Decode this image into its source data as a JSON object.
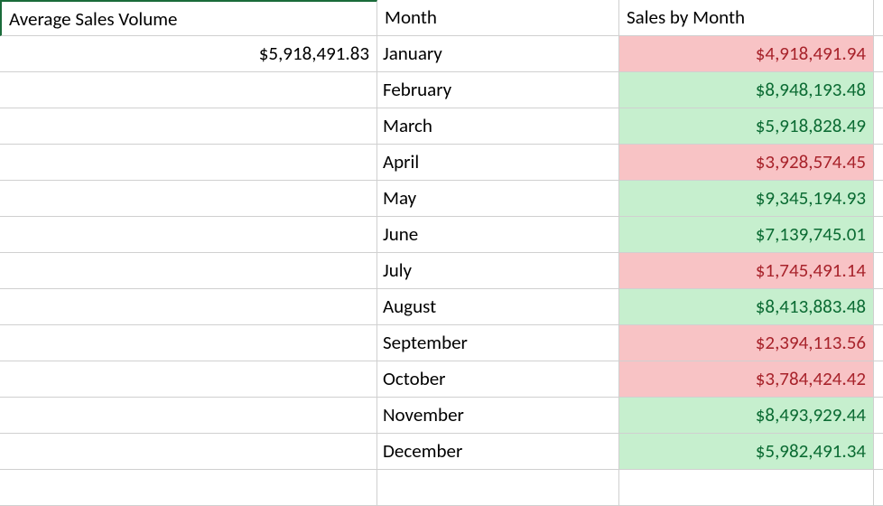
{
  "headers": {
    "avg_sales_volume": "Average Sales Volume",
    "month": "Month",
    "sales_by_month": "Sales by Month"
  },
  "average_value": "$5,918,491.83",
  "rows": [
    {
      "month": "January",
      "sales": "$4,918,491.94",
      "status": "bad"
    },
    {
      "month": "February",
      "sales": "$8,948,193.48",
      "status": "good"
    },
    {
      "month": "March",
      "sales": "$5,918,828.49",
      "status": "good"
    },
    {
      "month": "April",
      "sales": "$3,928,574.45",
      "status": "bad"
    },
    {
      "month": "May",
      "sales": "$9,345,194.93",
      "status": "good"
    },
    {
      "month": "June",
      "sales": "$7,139,745.01",
      "status": "good"
    },
    {
      "month": "July",
      "sales": "$1,745,491.14",
      "status": "bad"
    },
    {
      "month": "August",
      "sales": "$8,413,883.48",
      "status": "good"
    },
    {
      "month": "September",
      "sales": "$2,394,113.56",
      "status": "bad"
    },
    {
      "month": "October",
      "sales": "$3,784,424.42",
      "status": "bad"
    },
    {
      "month": "November",
      "sales": "$8,493,929.44",
      "status": "good"
    },
    {
      "month": "December",
      "sales": "$5,982,491.34",
      "status": "good"
    }
  ],
  "chart_data": {
    "type": "table",
    "title": "Sales by Month vs Average Sales Volume",
    "average_sales_volume": 5918491.83,
    "categories": [
      "January",
      "February",
      "March",
      "April",
      "May",
      "June",
      "July",
      "August",
      "September",
      "October",
      "November",
      "December"
    ],
    "values": [
      4918491.94,
      8948193.48,
      5918828.49,
      3928574.45,
      9345194.93,
      7139745.01,
      1745491.14,
      8413883.48,
      2394113.56,
      3784424.42,
      8493929.44,
      5982491.34
    ],
    "xlabel": "Month",
    "ylabel": "Sales"
  }
}
